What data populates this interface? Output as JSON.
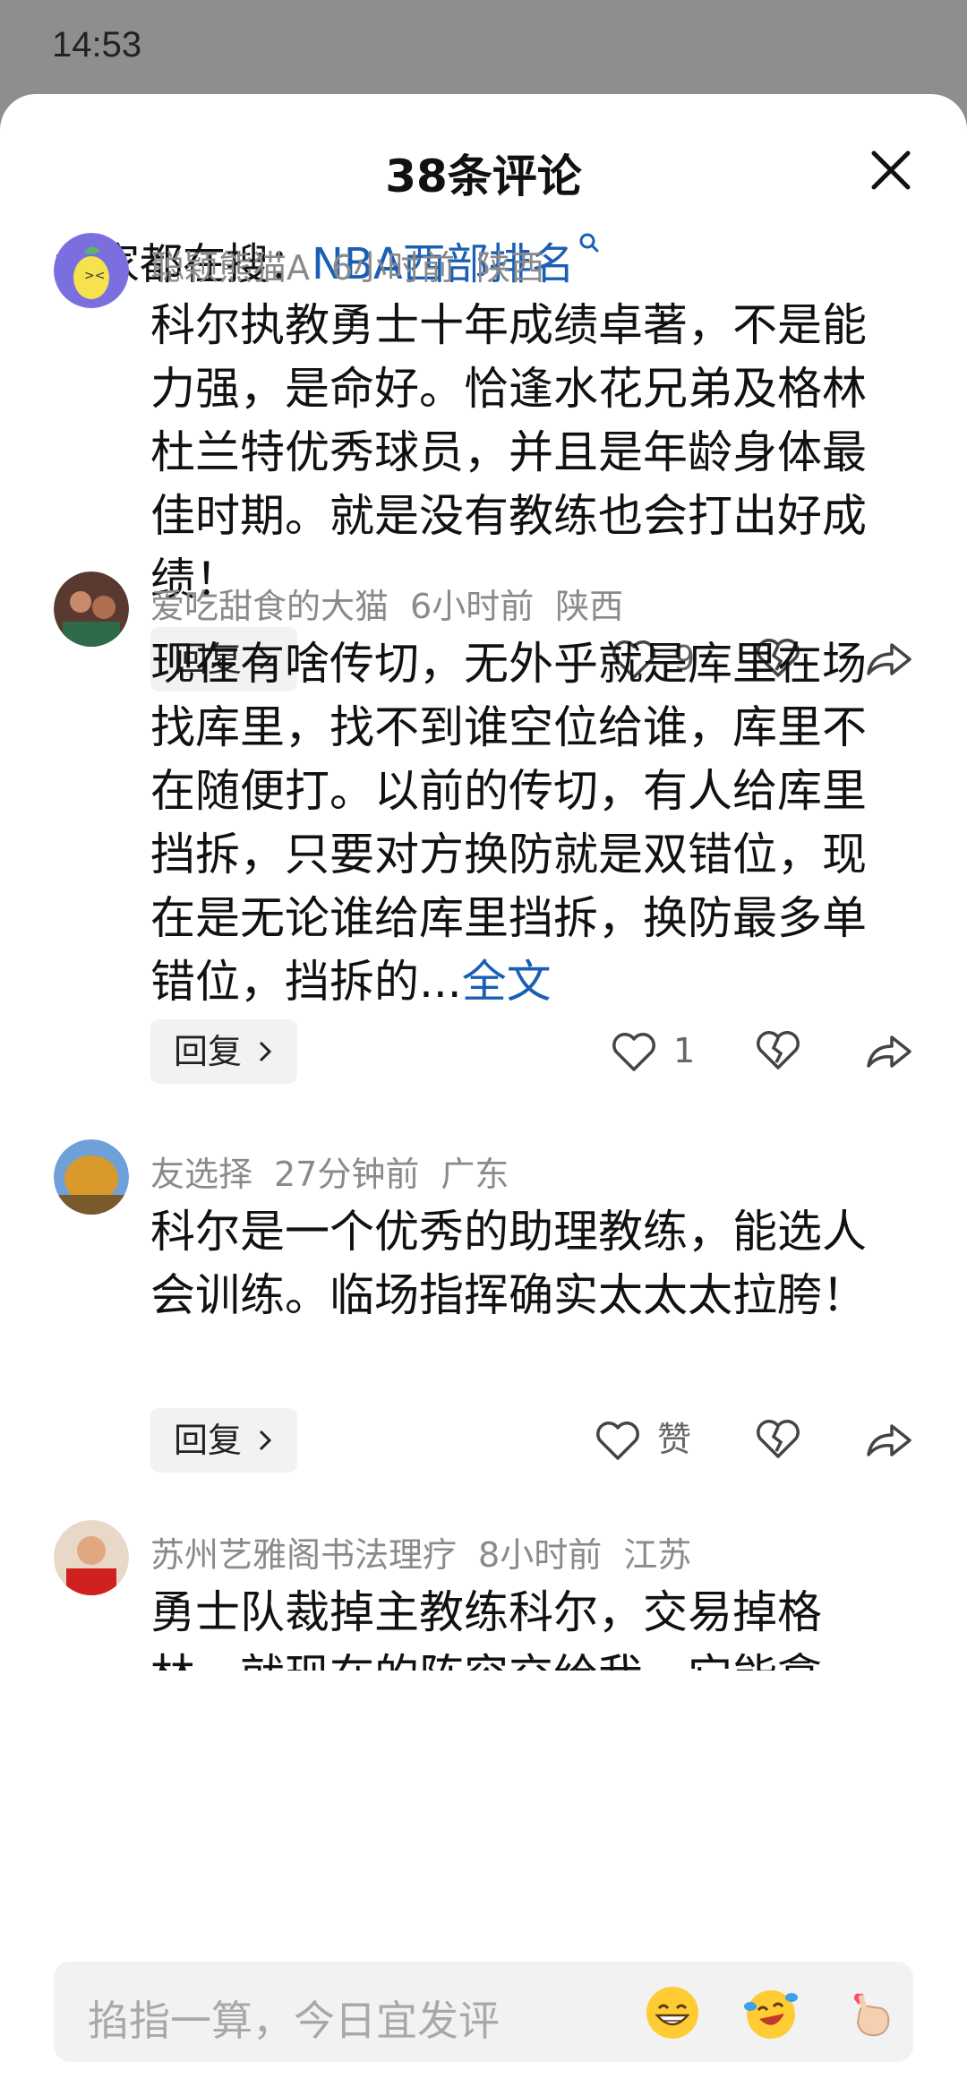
{
  "status_bar": {
    "time": "14:53"
  },
  "sheet": {
    "title": "38条评论",
    "search_prefix": "大家都在搜：",
    "search_term": "NBA西部排名"
  },
  "comments": [
    {
      "user": "聪颖熊猫A",
      "time": "6小时前",
      "location": "陕西",
      "text": "科尔执教勇士十年成绩卓著，不是能力强，是命好。恰逢水花兄弟及格林杜兰特优秀球员，并且是年龄身体最佳时期。就是没有教练也会打出好成绩！",
      "more": "",
      "reply_label": "回复",
      "likes": "9"
    },
    {
      "user": "爱吃甜食的大猫",
      "time": "6小时前",
      "location": "陕西",
      "text": "现在有啥传切，无外乎就是库里在场找库里，找不到谁空位给谁，库里不在随便打。以前的传切，有人给库里挡拆，只要对方换防就是双错位，现在是无论谁给库里挡拆，换防最多单错位，挡拆的...",
      "more": "全文",
      "reply_label": "回复",
      "likes": "1"
    },
    {
      "user": "友选择",
      "time": "27分钟前",
      "location": "广东",
      "text": "科尔是一个优秀的助理教练，能选人会训练。临场指挥确实太太太拉胯！",
      "more": "",
      "reply_label": "回复",
      "likes": "赞"
    },
    {
      "user": "苏州艺雅阁书法理疗",
      "time": "8小时前",
      "location": "江苏",
      "text": "勇士队裁掉主教练科尔，交易掉格林，就现在的阵容交给我，它能拿",
      "more": "",
      "reply_label": "",
      "likes": ""
    }
  ],
  "input": {
    "placeholder": "掐指一算，今日宜发评"
  },
  "colors": {
    "link": "#1a5fb4",
    "meta": "#8a8a8a",
    "statusbar": "#8e8e8e"
  }
}
